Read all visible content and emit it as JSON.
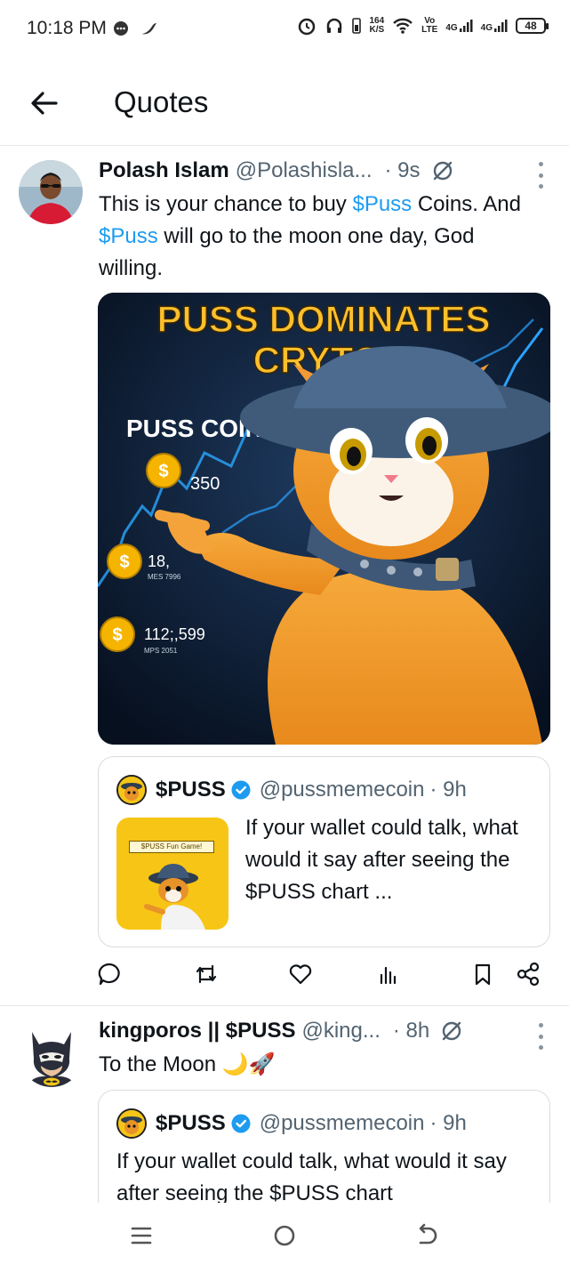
{
  "status_bar": {
    "time": "10:18 PM",
    "speed_value": "164",
    "speed_unit": "K/S",
    "volte_top": "Vo",
    "volte_bottom": "LTE",
    "sim1": "4G",
    "sim2": "4G",
    "battery": "48",
    "icons": [
      "chat-bubble-icon",
      "chili-icon",
      "alarm-icon",
      "headphones-icon",
      "phone-battery-icon",
      "wifi-icon",
      "signal-icon"
    ]
  },
  "header": {
    "title": "Quotes",
    "back_icon": "arrow-left-icon"
  },
  "posts": [
    {
      "name": "Polash Islam",
      "handle": "@Polashisla...",
      "time": "· 9s",
      "text_parts": [
        "This is your chance to buy ",
        "$Puss",
        " Coins. And ",
        "$Puss",
        " will go to the moon one day, God willing."
      ],
      "media": {
        "headline_1": "PUSS DOMINATES",
        "headline_2": "CRYTO!",
        "coin_label": "PUSS COIN",
        "coin_1": "350",
        "coin_2": "18,",
        "coin_2_sub": "MES 7996",
        "coin_3": "112;,599",
        "coin_3_sub": "MPS 2051",
        "coin_symbol": "$"
      },
      "quote": {
        "name": "$PUSS",
        "handle": "@pussmemecoin",
        "time": "· 9h",
        "thumb_label": "$PUSS Fun Game!",
        "text": "If your wallet could talk, what would it say after seeing the $PUSS chart ..."
      }
    },
    {
      "name": "kingporos || $PUSS",
      "handle": "@king...",
      "time": "· 8h",
      "text": "To the Moon 🌙🚀",
      "quote": {
        "name": "$PUSS",
        "handle": "@pussmemecoin",
        "time": "· 9h",
        "text": "If your wallet could talk, what would it say after seeing the $PUSS chart"
      }
    }
  ],
  "actions": [
    "reply-icon",
    "repost-icon",
    "like-icon",
    "views-icon",
    "bookmark-icon",
    "share-icon"
  ],
  "nav": [
    "recent-apps-icon",
    "home-icon",
    "back-icon"
  ]
}
